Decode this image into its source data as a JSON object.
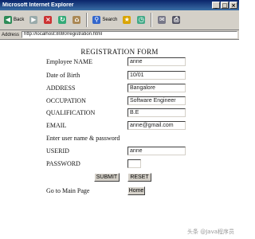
{
  "window": {
    "title": "Microsoft Internet Explorer",
    "controls": [
      "_",
      "□",
      "×"
    ]
  },
  "toolbar": {
    "buttons": [
      {
        "label": "Back",
        "icon": "back-arrow-icon"
      },
      {
        "label": "",
        "icon": "forward-arrow-icon"
      },
      {
        "label": "",
        "icon": "stop-icon"
      },
      {
        "label": "",
        "icon": "refresh-icon"
      },
      {
        "label": "",
        "icon": "home-icon"
      },
      {
        "label": "Search",
        "icon": "search-icon"
      },
      {
        "label": "",
        "icon": "favorites-icon"
      },
      {
        "label": "",
        "icon": "history-icon"
      },
      {
        "label": "",
        "icon": "mail-icon"
      },
      {
        "label": "",
        "icon": "print-icon"
      }
    ]
  },
  "address": {
    "label": "Address",
    "url": "http://localhost:8080/registration.html"
  },
  "form": {
    "title": "REGISTRATION FORM",
    "fields": [
      {
        "label": "Employee NAME",
        "value": "anne"
      },
      {
        "label": "Date of Birth",
        "value": "10/01"
      },
      {
        "label": "ADDRESS",
        "value": "Bangalore"
      },
      {
        "label": "OCCUPATION",
        "value": "Software Engineer"
      },
      {
        "label": "QUALIFICATION",
        "value": "B.E"
      },
      {
        "label": "EMAIL",
        "value": "anne@gmail.com"
      }
    ],
    "credentials_heading": "Enter user name & password",
    "username": {
      "label": "USERID",
      "value": "anne"
    },
    "password": {
      "label": "PASSWORD",
      "value": ""
    },
    "submit_label": "SUBMIT",
    "reset_label": "RESET",
    "home_prompt": "Go to Main Page",
    "home_label": "Home"
  },
  "watermark": "头条 @Java程序员"
}
